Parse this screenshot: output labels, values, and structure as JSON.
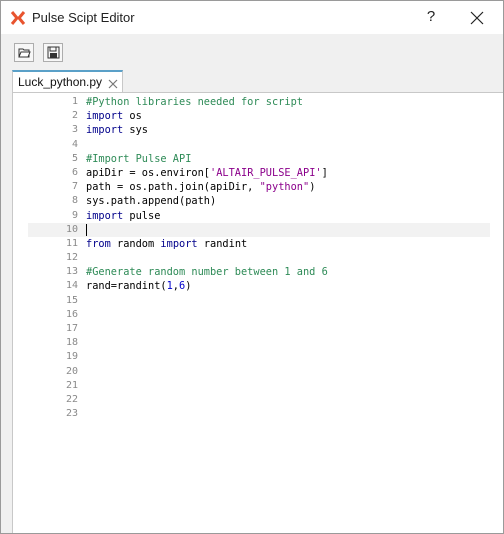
{
  "window": {
    "title": "Pulse Scipt Editor",
    "help_label": "?",
    "accent": "#e8542f"
  },
  "toolbar": {
    "buttons": [
      {
        "icon": "open-folder-icon"
      },
      {
        "icon": "save-icon"
      }
    ]
  },
  "tabs": [
    {
      "label": "Luck_python.py",
      "close_icon": "close-icon"
    }
  ],
  "editor": {
    "current_line": 10,
    "lines": [
      {
        "n": "1",
        "tokens": [
          {
            "t": "#Python libraries needed for script",
            "c": "cm"
          }
        ]
      },
      {
        "n": "2",
        "tokens": [
          {
            "t": "import",
            "c": "kw"
          },
          {
            "t": " os",
            "c": ""
          }
        ]
      },
      {
        "n": "3",
        "tokens": [
          {
            "t": "import",
            "c": "kw"
          },
          {
            "t": " sys",
            "c": ""
          }
        ]
      },
      {
        "n": "4",
        "tokens": []
      },
      {
        "n": "5",
        "tokens": [
          {
            "t": "#Import Pulse API",
            "c": "cm"
          }
        ]
      },
      {
        "n": "6",
        "tokens": [
          {
            "t": "apiDir = os.environ[",
            "c": ""
          },
          {
            "t": "'ALTAIR_PULSE_API'",
            "c": "str"
          },
          {
            "t": "]",
            "c": ""
          }
        ]
      },
      {
        "n": "7",
        "tokens": [
          {
            "t": "path = os.path.join(apiDir, ",
            "c": ""
          },
          {
            "t": "\"python\"",
            "c": "str"
          },
          {
            "t": ")",
            "c": ""
          }
        ]
      },
      {
        "n": "8",
        "tokens": [
          {
            "t": "sys.path.append(path)",
            "c": ""
          }
        ]
      },
      {
        "n": "9",
        "tokens": [
          {
            "t": "import",
            "c": "kw"
          },
          {
            "t": " pulse",
            "c": ""
          }
        ]
      },
      {
        "n": "10",
        "tokens": []
      },
      {
        "n": "11",
        "tokens": [
          {
            "t": "from",
            "c": "kw"
          },
          {
            "t": " random ",
            "c": ""
          },
          {
            "t": "import",
            "c": "kw"
          },
          {
            "t": " randint",
            "c": ""
          }
        ]
      },
      {
        "n": "12",
        "tokens": []
      },
      {
        "n": "13",
        "tokens": [
          {
            "t": "#Generate random number between 1 and 6",
            "c": "cm"
          }
        ]
      },
      {
        "n": "14",
        "tokens": [
          {
            "t": "rand=randint(",
            "c": ""
          },
          {
            "t": "1",
            "c": "num"
          },
          {
            "t": ",",
            "c": ""
          },
          {
            "t": "6",
            "c": "num"
          },
          {
            "t": ")",
            "c": ""
          }
        ]
      },
      {
        "n": "15",
        "tokens": []
      },
      {
        "n": "16",
        "tokens": []
      },
      {
        "n": "17",
        "tokens": []
      },
      {
        "n": "18",
        "tokens": []
      },
      {
        "n": "19",
        "tokens": []
      },
      {
        "n": "20",
        "tokens": []
      },
      {
        "n": "21",
        "tokens": []
      },
      {
        "n": "22",
        "tokens": []
      },
      {
        "n": "23",
        "tokens": []
      }
    ]
  }
}
